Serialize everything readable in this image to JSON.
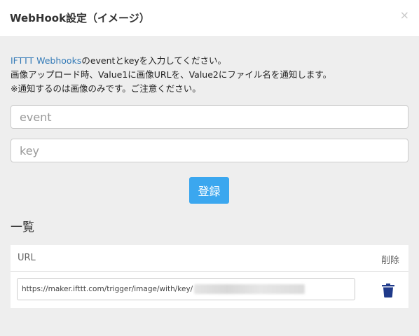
{
  "dialog": {
    "title": "WebHook設定（イメージ）",
    "close_label": "×"
  },
  "description": {
    "link_text": "IFTTT Webhooks",
    "line1_rest": "のeventとkeyを入力してください。",
    "line2": "画像アップロード時、Value1に画像URLを、Value2にファイル名を通知します。",
    "line3": "※通知するのは画像のみです。ご注意ください。"
  },
  "form": {
    "event_placeholder": "event",
    "key_placeholder": "key",
    "register_label": "登録"
  },
  "list": {
    "title": "一覧",
    "columns": [
      "URL",
      "削除"
    ],
    "rows": [
      {
        "url": "https://maker.ifttt.com/trigger/image/with/key/"
      }
    ]
  },
  "icons": {
    "delete": "trash-icon",
    "close": "close-icon"
  },
  "colors": {
    "accent": "#3ba7ef",
    "link": "#337ab7",
    "delete_icon": "#1f3a8a",
    "background": "#eeeeee"
  }
}
